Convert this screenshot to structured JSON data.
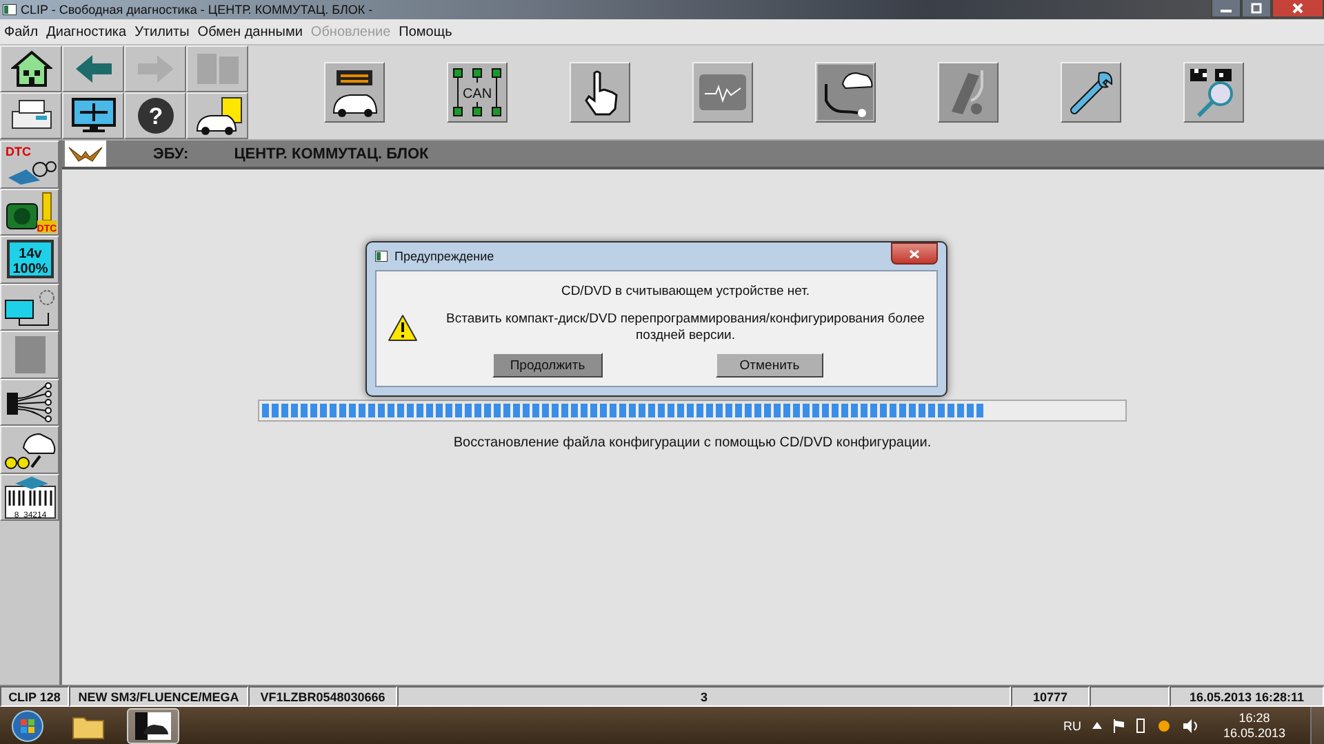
{
  "window": {
    "title": "CLIP - Свободная диагностика - ЦЕНТР. КОММУТАЦ. БЛОК -"
  },
  "menu": [
    {
      "label": "Файл",
      "disabled": false
    },
    {
      "label": "Диагностика",
      "disabled": false
    },
    {
      "label": "Утилиты",
      "disabled": false
    },
    {
      "label": "Обмен данными",
      "disabled": false
    },
    {
      "label": "Обновление",
      "disabled": true
    },
    {
      "label": "Помощь",
      "disabled": false
    }
  ],
  "toolbar_small": [
    {
      "kind": "home",
      "disabled": false
    },
    {
      "kind": "back",
      "disabled": false
    },
    {
      "kind": "forward",
      "disabled": true
    },
    {
      "kind": "pages",
      "disabled": true
    },
    {
      "kind": "printer",
      "disabled": false
    },
    {
      "kind": "screen",
      "disabled": false
    },
    {
      "kind": "help",
      "text": "?",
      "disabled": false
    },
    {
      "kind": "report",
      "disabled": false
    }
  ],
  "toolbar_big": [
    {
      "kind": "ecu-car",
      "disabled": false
    },
    {
      "kind": "can",
      "text": "CAN",
      "disabled": false
    },
    {
      "kind": "hand",
      "disabled": false
    },
    {
      "kind": "wave",
      "disabled": false
    },
    {
      "kind": "stetho-car",
      "disabled": false
    },
    {
      "kind": "stetho-seat",
      "disabled": true
    },
    {
      "kind": "wrench",
      "disabled": false
    },
    {
      "kind": "flags",
      "disabled": false
    }
  ],
  "sidebar": [
    {
      "kind": "dtc-glasses",
      "text": "DTC"
    },
    {
      "kind": "camera-dtc",
      "text": "DTC"
    },
    {
      "kind": "battery",
      "text": "14v",
      "text2": "100%"
    },
    {
      "kind": "screen-sun"
    },
    {
      "kind": "blank"
    },
    {
      "kind": "connector"
    },
    {
      "kind": "car-keys"
    },
    {
      "kind": "barcode",
      "text": "8  34214"
    }
  ],
  "header": {
    "ecu_label": "ЭБУ:",
    "ecu_name": "ЦЕНТР. КОММУТАЦ. БЛОК"
  },
  "progress": {
    "level": 0.84,
    "caption": "Восстановление файла конфигурации с помощью CD/DVD конфигурации."
  },
  "dialog": {
    "title": "Предупреждение",
    "message": "CD/DVD в считывающем устройстве нет.",
    "detail": "Вставить компакт-диск/DVD перепрограммирования/конфигурирования более поздней версии.",
    "buttons": [
      {
        "label": "Продолжить",
        "selected": true
      },
      {
        "label": "Отменить",
        "selected": false
      }
    ]
  },
  "status_bar": [
    "CLIP 128",
    "NEW SM3/FLUENCE/MEGA",
    "VF1LZBR0548030666",
    "3",
    "10777",
    "16.05.2013 16:28:11"
  ],
  "taskbar": {
    "language": "RU",
    "time": "16:28",
    "date": "16.05.2013"
  }
}
